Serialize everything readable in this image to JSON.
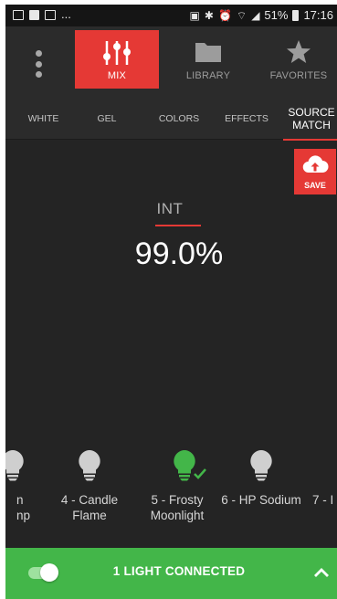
{
  "status_bar": {
    "left_ellipsis": "...",
    "battery": "51%",
    "time": "17:16"
  },
  "top_nav": {
    "tabs": [
      {
        "label": "MIX",
        "icon": "sliders-icon",
        "active": true
      },
      {
        "label": "LIBRARY",
        "icon": "folder-icon",
        "active": false
      },
      {
        "label": "FAVORITES",
        "icon": "star-icon",
        "active": false
      }
    ]
  },
  "sub_tabs": [
    {
      "label": "WHITE",
      "active": false
    },
    {
      "label": "GEL",
      "active": false
    },
    {
      "label": "COLORS",
      "active": false
    },
    {
      "label": "EFFECTS",
      "active": false
    },
    {
      "label": "SOURCE MATCH",
      "line1": "SOURCE",
      "line2": "MATCH",
      "active": true
    }
  ],
  "save_button": {
    "label": "SAVE"
  },
  "intensity": {
    "label": "INT",
    "value": "99.0%"
  },
  "presets": [
    {
      "line1": "n",
      "line2": "np",
      "selected": false
    },
    {
      "line1": "4 - Candle",
      "line2": "Flame",
      "selected": false
    },
    {
      "line1": "5 - Frosty",
      "line2": "Moonlight",
      "selected": true
    },
    {
      "line1": "6 - HP Sodium",
      "line2": "",
      "selected": false
    },
    {
      "line1": "7 - I",
      "line2": "",
      "selected": false
    }
  ],
  "bottom_bar": {
    "connection_label": "1 LIGHT CONNECTED",
    "toggle_on": true
  },
  "colors": {
    "accent": "#e53935",
    "connected_green": "#43b649",
    "background": "#242424"
  }
}
